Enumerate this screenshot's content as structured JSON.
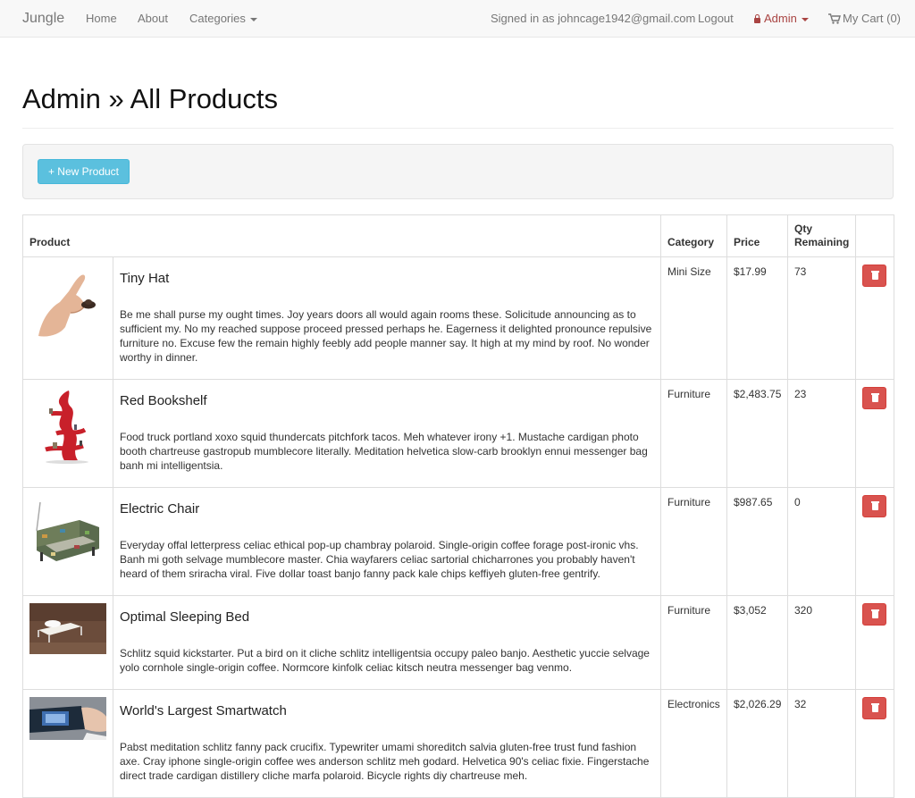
{
  "nav": {
    "brand": "Jungle",
    "home": "Home",
    "about": "About",
    "categories": "Categories",
    "signed_in": "Signed in as johncage1942@gmail.com",
    "logout": "Logout",
    "admin": "Admin",
    "cart": "My Cart (0)"
  },
  "page": {
    "title": "Admin » All Products",
    "new_product": "+ New Product"
  },
  "table": {
    "headers": {
      "product": "Product",
      "category": "Category",
      "price": "Price",
      "qty": "Qty Remaining"
    },
    "rows": [
      {
        "name": "Tiny Hat",
        "description": "Be me shall purse my ought times. Joy years doors all would again rooms these. Solicitude announcing as to sufficient my. No my reached suppose proceed pressed perhaps he. Eagerness it delighted pronounce repulsive furniture no. Excuse few the remain highly feebly add people manner say. It high at my mind by roof. No wonder worthy in dinner.",
        "category": "Mini Size",
        "price": "$17.99",
        "qty": "73"
      },
      {
        "name": "Red Bookshelf",
        "description": "Food truck portland xoxo squid thundercats pitchfork tacos. Meh whatever irony +1. Mustache cardigan photo booth chartreuse gastropub mumblecore literally. Meditation helvetica slow-carb brooklyn ennui messenger bag banh mi intelligentsia.",
        "category": "Furniture",
        "price": "$2,483.75",
        "qty": "23"
      },
      {
        "name": "Electric Chair",
        "description": "Everyday offal letterpress celiac ethical pop-up chambray polaroid. Single-origin coffee forage post-ironic vhs. Banh mi goth selvage mumblecore master. Chia wayfarers celiac sartorial chicharrones you probably haven't heard of them sriracha viral. Five dollar toast banjo fanny pack kale chips keffiyeh gluten-free gentrify.",
        "category": "Furniture",
        "price": "$987.65",
        "qty": "0"
      },
      {
        "name": "Optimal Sleeping Bed",
        "description": "Schlitz squid kickstarter. Put a bird on it cliche schlitz intelligentsia occupy paleo banjo. Aesthetic yuccie selvage yolo cornhole single-origin coffee. Normcore kinfolk celiac kitsch neutra messenger bag venmo.",
        "category": "Furniture",
        "price": "$3,052",
        "qty": "320"
      },
      {
        "name": "World's Largest Smartwatch",
        "description": "Pabst meditation schlitz fanny pack crucifix. Typewriter umami shoreditch salvia gluten-free trust fund fashion axe. Cray iphone single-origin coffee wes anderson schlitz meh godard. Helvetica 90's celiac fixie. Fingerstache direct trade cardigan distillery cliche marfa polaroid. Bicycle rights diy chartreuse meh.",
        "category": "Electronics",
        "price": "$2,026.29",
        "qty": "32"
      }
    ]
  }
}
